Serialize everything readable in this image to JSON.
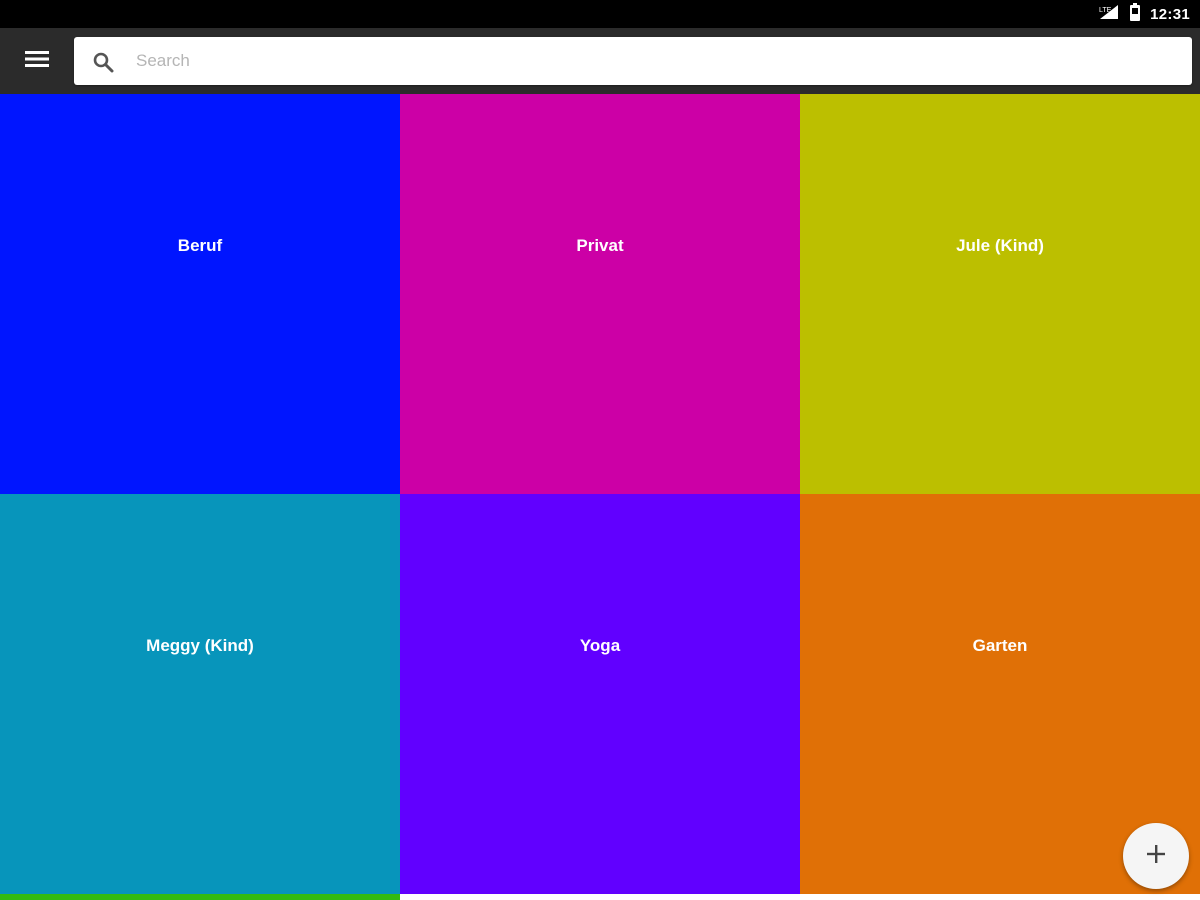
{
  "status_bar": {
    "time": "12:31",
    "icons": [
      "signal-icon",
      "battery-icon"
    ]
  },
  "toolbar": {
    "menu_icon": "menu-icon",
    "search": {
      "icon": "search-icon",
      "placeholder": "Search",
      "value": ""
    }
  },
  "categories": [
    {
      "label": "Beruf",
      "color": "#0015ff"
    },
    {
      "label": "Privat",
      "color": "#cc00a6"
    },
    {
      "label": "Jule (Kind)",
      "color": "#bcbf00"
    },
    {
      "label": "Meggy (Kind)",
      "color": "#0795bb"
    },
    {
      "label": "Yoga",
      "color": "#6100ff"
    },
    {
      "label": "Garten",
      "color": "#e07006"
    }
  ],
  "next_row_partial": {
    "color": "#33bb11"
  },
  "fab": {
    "icon": "plus-icon"
  },
  "colors": {
    "status_bar": "#000000",
    "toolbar": "#2b2b2b",
    "search_background": "#ffffff"
  }
}
